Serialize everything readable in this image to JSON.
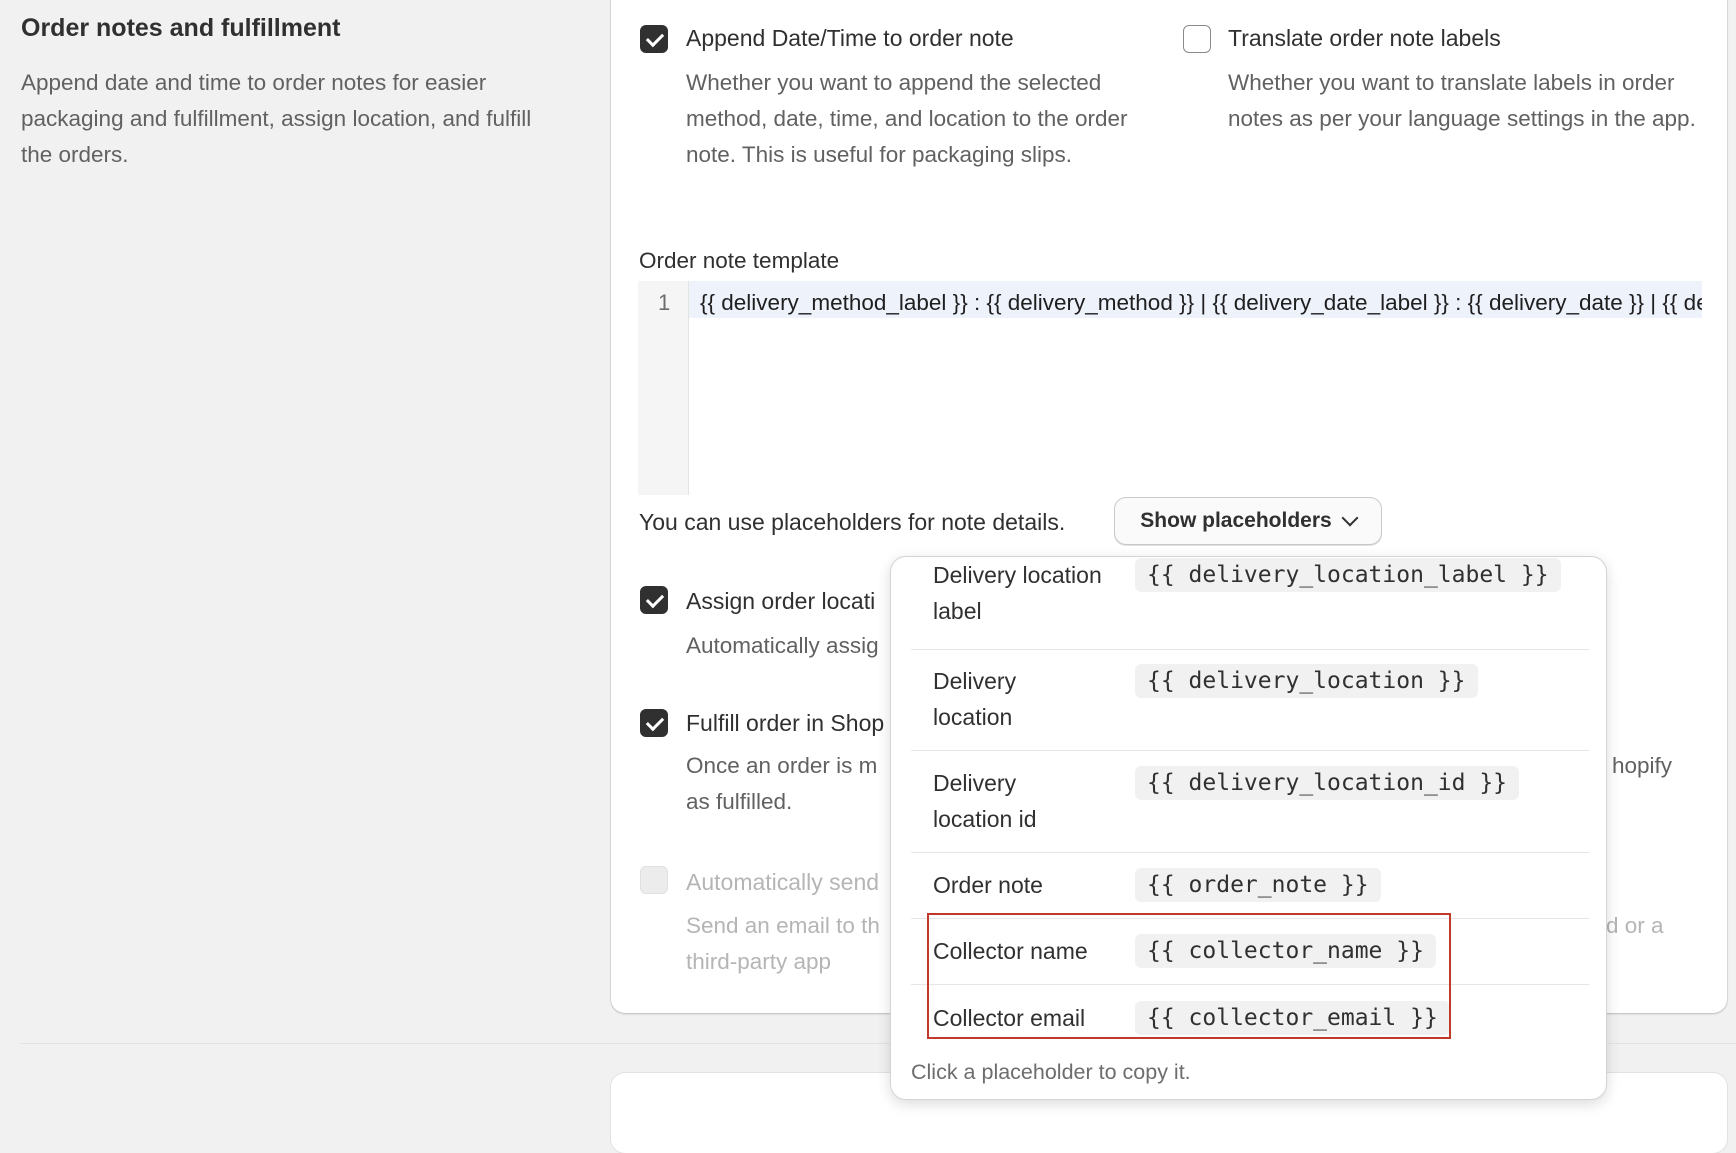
{
  "section": {
    "title": "Order notes and fulfillment",
    "description": "Append date and time to order notes for easier packaging and fulfillment, assign location, and fulfill the orders."
  },
  "options": {
    "append": {
      "checked": true,
      "label": "Append Date/Time to order note",
      "description": "Whether you want to append the selected method, date, time, and location to the order note. This is useful for packaging slips."
    },
    "translate": {
      "checked": false,
      "label": "Translate order note labels",
      "description": "Whether you want to translate labels in order notes as per your language settings in the app."
    },
    "assign": {
      "checked": true,
      "label": "Assign order locati",
      "description": "Automatically assig"
    },
    "fulfill": {
      "checked": true,
      "label": "Fulfill order in Shop",
      "description_left_1": "Once an order is m",
      "description_right": "hopify",
      "description_left_2": "as fulfilled."
    },
    "send_email": {
      "checked": false,
      "disabled": true,
      "label": "Automatically send",
      "description_left_1": "Send an email to th",
      "description_right": "d or a",
      "description_left_2": "third-party app"
    }
  },
  "template": {
    "label": "Order note template",
    "line_number": "1",
    "code": "{{ delivery_method_label }} : {{ delivery_method }} | {{ delivery_date_label }} : {{ delivery_date }} | {{ delivery_time_label }} : {{ delivery_time }}"
  },
  "placeholders": {
    "hint": "You can use placeholders for note details.",
    "button_label": "Show placeholders",
    "rows": [
      {
        "name": "Delivery location label",
        "tag": "{{ delivery_location_label }}"
      },
      {
        "name": "Delivery location",
        "tag": "{{ delivery_location }}"
      },
      {
        "name": "Delivery location id",
        "tag": "{{ delivery_location_id }}"
      },
      {
        "name": "Order note",
        "tag": "{{ order_note }}"
      },
      {
        "name": "Collector name",
        "tag": "{{ collector_name }}"
      },
      {
        "name": "Collector email",
        "tag": "{{ collector_email }}"
      }
    ],
    "footer": "Click a placeholder to copy it."
  },
  "colors": {
    "accent_dark": "#303030",
    "highlight_border": "#c0392b",
    "muted_text": "#616161"
  }
}
